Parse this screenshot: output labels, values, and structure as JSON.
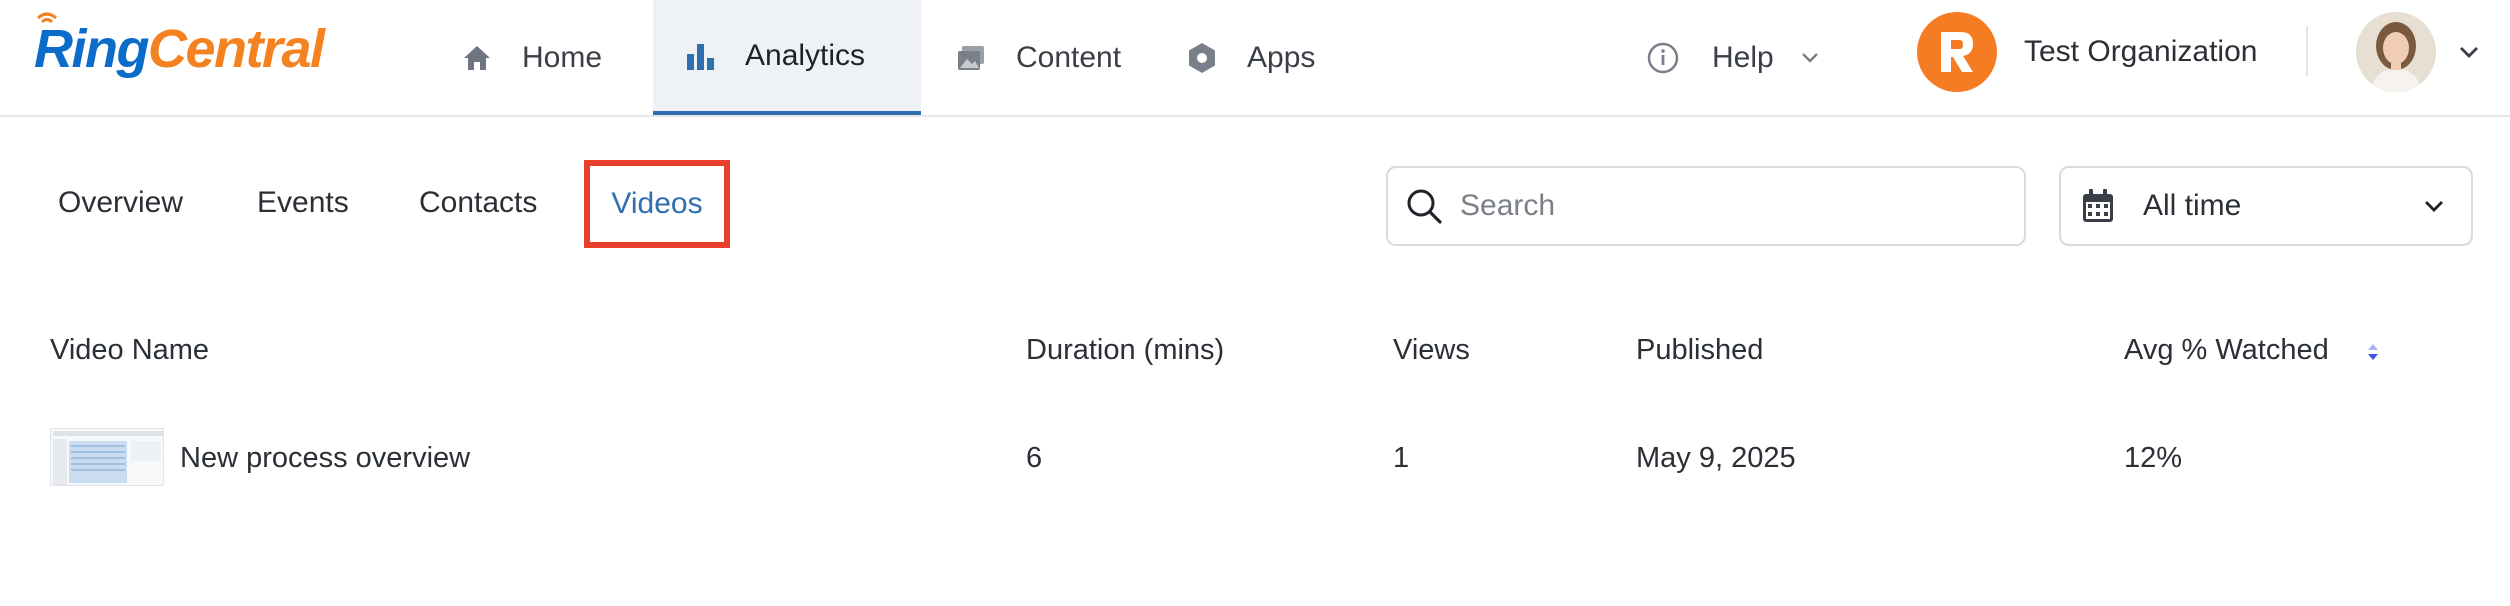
{
  "brand": {
    "part1": "Ring",
    "part2": "Central"
  },
  "nav": {
    "home": "Home",
    "analytics": "Analytics",
    "content": "Content",
    "apps": "Apps",
    "help": "Help"
  },
  "org": {
    "badge_letter": "R",
    "name": "Test Organization"
  },
  "subtabs": {
    "overview": "Overview",
    "events": "Events",
    "contacts": "Contacts",
    "videos": "Videos",
    "active": "videos"
  },
  "search": {
    "placeholder": "Search",
    "value": ""
  },
  "date_filter": {
    "selected": "All time"
  },
  "table": {
    "headers": {
      "name": "Video Name",
      "duration": "Duration (mins)",
      "views": "Views",
      "published": "Published",
      "watched": "Avg % Watched"
    },
    "rows": [
      {
        "name": "New process overview",
        "duration": "6",
        "views": "1",
        "published": "May 9, 2025",
        "watched": "12%"
      }
    ]
  },
  "colors": {
    "accent": "#2f6fb0",
    "brand_blue": "#0b6cc9",
    "brand_orange": "#f58220",
    "highlight_box": "#e8402d",
    "org_badge": "#f57c22"
  },
  "icons": {
    "home": "home-icon",
    "analytics": "bar-chart-icon",
    "content": "image-stack-icon",
    "apps": "hexagon-icon",
    "help": "info-circle-icon",
    "search": "search-icon",
    "calendar": "calendar-icon",
    "chevron": "chevron-down-icon",
    "sort": "sort-icon"
  }
}
